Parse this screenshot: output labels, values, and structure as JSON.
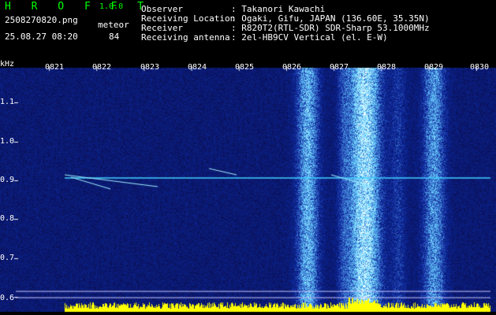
{
  "header": {
    "brand": "H R O F F T",
    "version": "1.0.0",
    "filename": "2508270820.png",
    "datetime": "25.08.27 08:20",
    "meteor_label": "meteor",
    "meteor_count": "84",
    "observer_label": "Observer",
    "observer_value": ": Takanori Kawachi",
    "location_label": "Receiving Location",
    "location_value": ": Ogaki, Gifu, JAPAN (136.60E, 35.35N)",
    "receiver_label": "Receiver",
    "receiver_value": ": R820T2(RTL-SDR) SDR-Sharp 53.1000MHz",
    "antenna_label": "Receiving antenna",
    "antenna_value": ": 2el-HB9CV Vertical (el. E-W)"
  },
  "axis": {
    "y_unit": "kHz",
    "y_ticks": [
      "1.1",
      "1.0",
      "0.9",
      "0.8",
      "0.7",
      "0.6"
    ],
    "x_ticks": [
      "0821",
      "0822",
      "0823",
      "0824",
      "0825",
      "0826",
      "0827",
      "0828",
      "0829",
      "0830"
    ]
  },
  "colors": {
    "background": "#000000",
    "spectrogram_base": "#10106a",
    "brand_green": "#00ff00",
    "carrier_line": "#40d0ff",
    "level_bar": "#ffff00"
  }
}
